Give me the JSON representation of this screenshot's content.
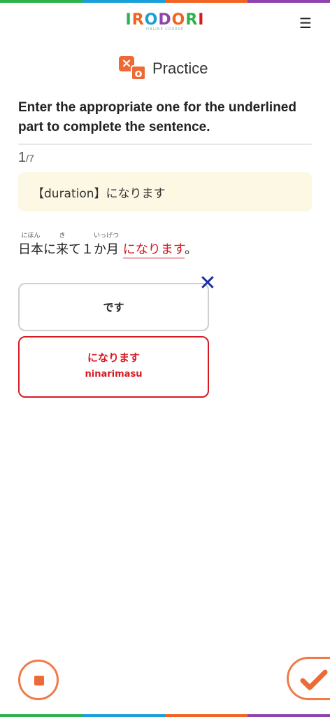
{
  "colors": {
    "stripe": [
      "#2bb24c",
      "#1a9fd8",
      "#f26322",
      "#8e44ad"
    ],
    "accent": "#f07a4a",
    "correct": "#d71a21",
    "wrong_mark": "#1b2ea0",
    "hint_bg": "#fdf8e4"
  },
  "header": {
    "logo_letters": [
      "I",
      "R",
      "O",
      "D",
      "O",
      "R",
      "I"
    ],
    "logo_colors": [
      "#2bb24c",
      "#f26322",
      "#1a9fd8",
      "#8e44ad",
      "#f26322",
      "#2bb24c",
      "#d71a21"
    ],
    "logo_subtitle": "ONLINE COURSE",
    "menu_icon": "hamburger-menu-icon",
    "menu_glyph": "☰"
  },
  "practice": {
    "title": "Practice",
    "icon": "practice-xo-icon",
    "x_glyph": "×",
    "o_glyph": "o"
  },
  "question": {
    "instruction": "Enter the appropriate one for the underlined part to complete the sentence.",
    "progress_current": "1",
    "progress_total": "/7",
    "hint": "【duration】になります"
  },
  "sentence": {
    "segments": [
      {
        "text": "日本",
        "ruby": "にほん"
      },
      {
        "text": "に",
        "ruby": ""
      },
      {
        "text": "来",
        "ruby": "き"
      },
      {
        "text": "て１",
        "ruby": ""
      },
      {
        "text": "か",
        "ruby": "いっ"
      },
      {
        "text": "月",
        "ruby": "げつ"
      }
    ],
    "answer": "になります",
    "end": "。"
  },
  "choices": {
    "wrong": {
      "jp": "です",
      "mark": "✕"
    },
    "correct": {
      "jp": "になります",
      "romaji": "ninarimasu"
    }
  },
  "footer": {
    "stop_icon": "stop-icon",
    "check_icon": "check-icon"
  }
}
